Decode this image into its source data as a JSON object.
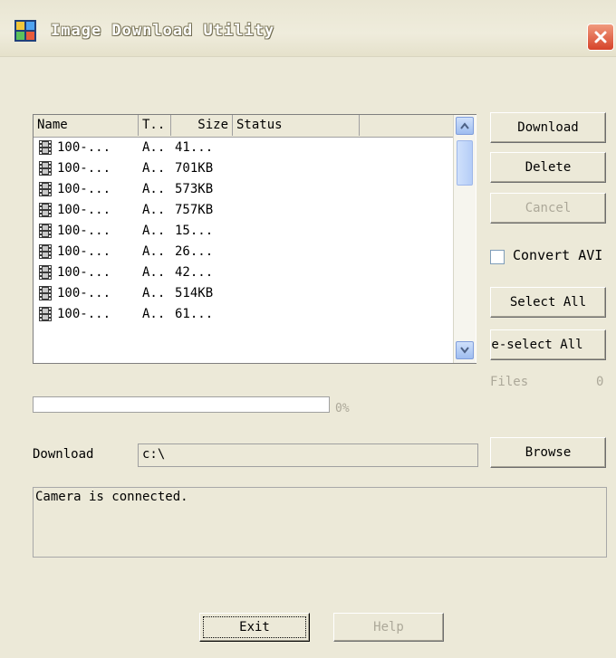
{
  "window": {
    "title": "Image Download Utility",
    "close_icon": "close-x-icon"
  },
  "list": {
    "columns": [
      "Name",
      "T..",
      "Size",
      "Status"
    ],
    "rows": [
      {
        "name": "100-...",
        "type": "A..",
        "size": "41...",
        "status": ""
      },
      {
        "name": "100-...",
        "type": "A..",
        "size": "701KB",
        "status": ""
      },
      {
        "name": "100-...",
        "type": "A..",
        "size": "573KB",
        "status": ""
      },
      {
        "name": "100-...",
        "type": "A..",
        "size": "757KB",
        "status": ""
      },
      {
        "name": "100-...",
        "type": "A..",
        "size": "15...",
        "status": ""
      },
      {
        "name": "100-...",
        "type": "A..",
        "size": "26...",
        "status": ""
      },
      {
        "name": "100-...",
        "type": "A..",
        "size": "42...",
        "status": ""
      },
      {
        "name": "100-...",
        "type": "A..",
        "size": "514KB",
        "status": ""
      },
      {
        "name": "100-...",
        "type": "A..",
        "size": "61...",
        "status": ""
      }
    ],
    "row_icon": "film-icon"
  },
  "buttons": {
    "download": "Download",
    "delete": "Delete",
    "cancel": "Cancel",
    "convert_avi": "Convert AVI",
    "select_all": "Select All",
    "deselect_all": "De-select All",
    "browse": "Browse",
    "exit": "Exit",
    "help": "Help"
  },
  "convert_avi_checked": false,
  "files": {
    "label": "Files",
    "count": "0"
  },
  "progress": {
    "value": 0,
    "label": "0%"
  },
  "download_path": {
    "label": "Download",
    "value": "c:\\"
  },
  "status_message": "Camera is connected.",
  "colors": {
    "close_button": "#d6432a",
    "progress_fill": "#316ac5"
  }
}
